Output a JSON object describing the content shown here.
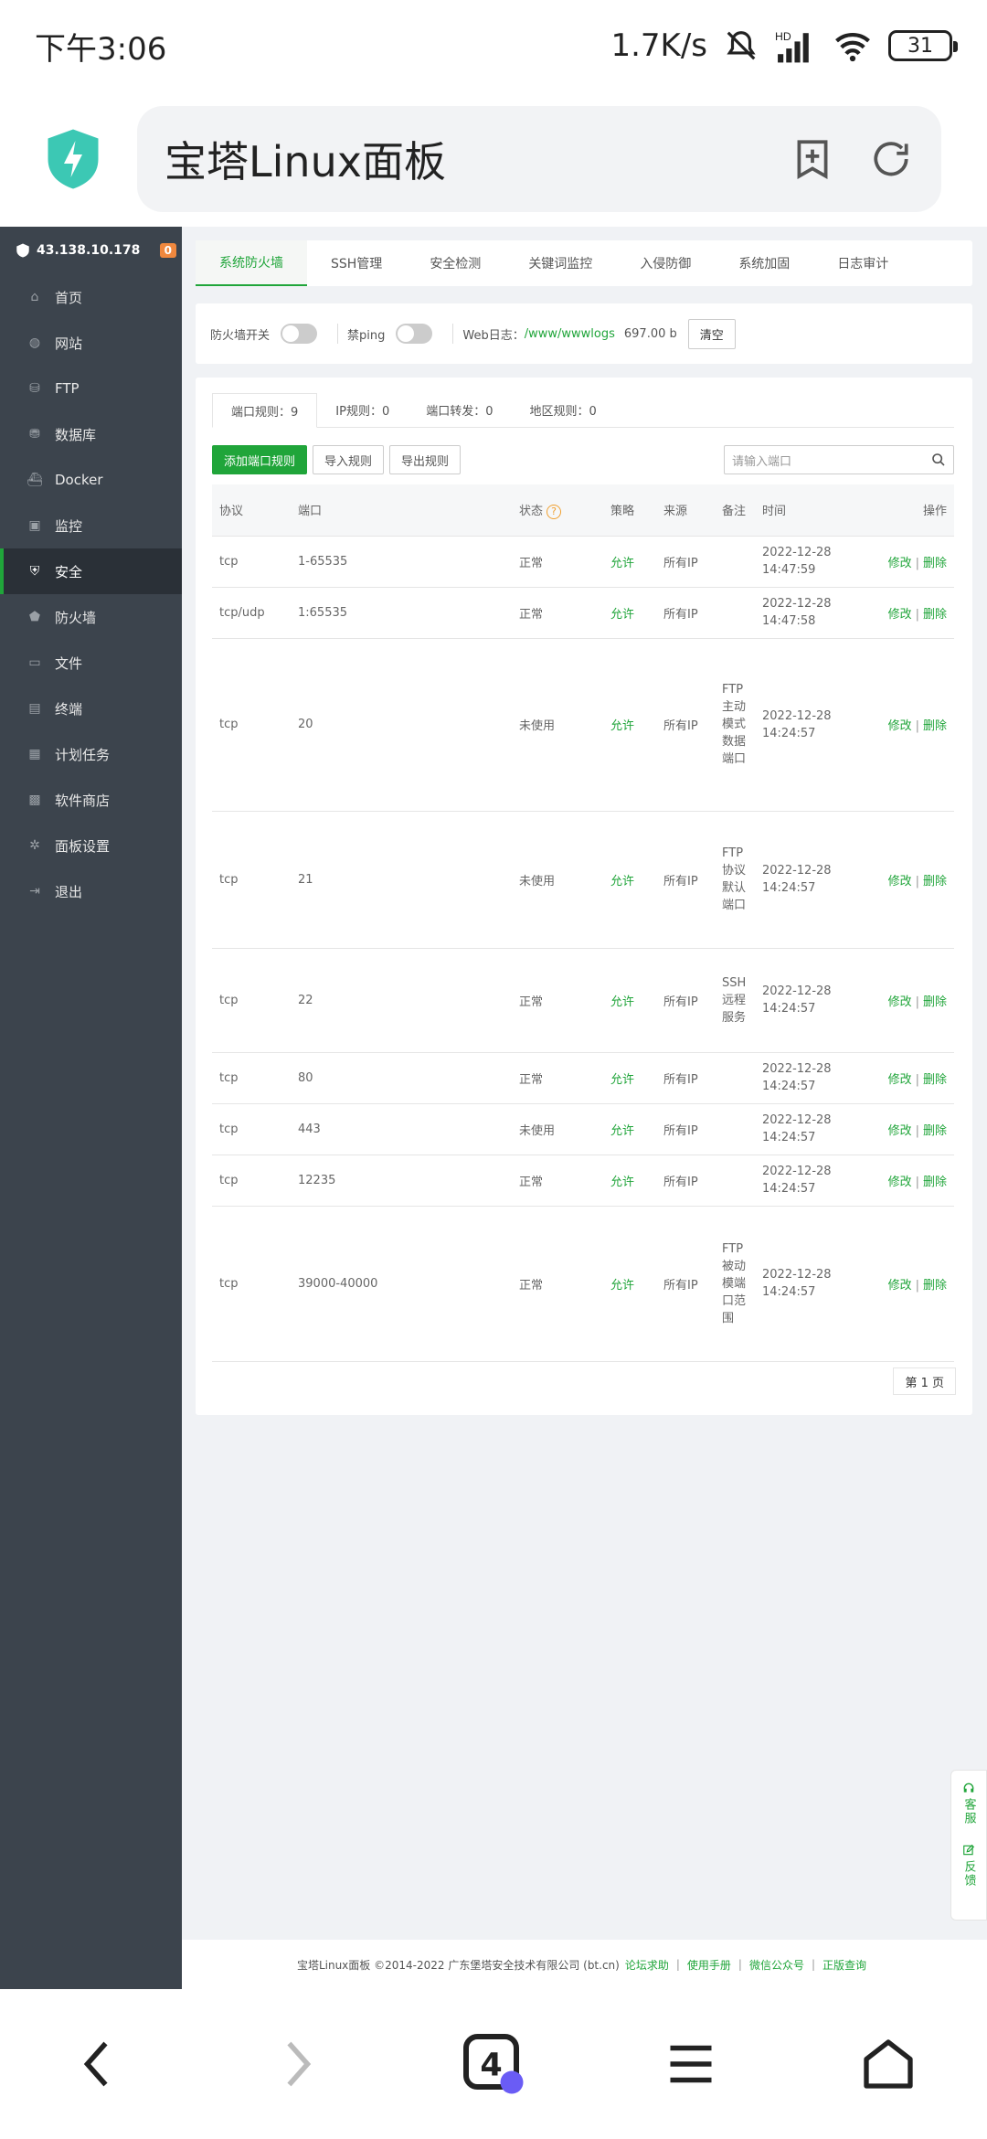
{
  "status_bar": {
    "time": "下午3:06",
    "network_speed": "1.7K/s",
    "battery": "31",
    "signal_label": "HD"
  },
  "browser": {
    "url_title": "宝塔Linux面板",
    "tab_count": "4"
  },
  "sidebar": {
    "ip": "43.138.10.178",
    "badge": "0",
    "items": [
      {
        "label": "首页",
        "icon": "home-icon"
      },
      {
        "label": "网站",
        "icon": "globe-icon"
      },
      {
        "label": "FTP",
        "icon": "ftp-icon"
      },
      {
        "label": "数据库",
        "icon": "database-icon"
      },
      {
        "label": "Docker",
        "icon": "docker-icon"
      },
      {
        "label": "监控",
        "icon": "monitor-icon"
      },
      {
        "label": "安全",
        "icon": "shield-icon"
      },
      {
        "label": "防火墙",
        "icon": "firewall-icon"
      },
      {
        "label": "文件",
        "icon": "folder-icon"
      },
      {
        "label": "终端",
        "icon": "terminal-icon"
      },
      {
        "label": "计划任务",
        "icon": "calendar-icon"
      },
      {
        "label": "软件商店",
        "icon": "apps-icon"
      },
      {
        "label": "面板设置",
        "icon": "gear-icon"
      },
      {
        "label": "退出",
        "icon": "logout-icon"
      }
    ]
  },
  "tabs": [
    "系统防火墙",
    "SSH管理",
    "安全检测",
    "关键词监控",
    "入侵防御",
    "系统加固",
    "日志审计"
  ],
  "controls": {
    "firewall_switch": "防火墙开关",
    "ping_label": "禁ping",
    "weblog_label": "Web日志：",
    "weblog_path": "/www/wwwlogs",
    "weblog_size": "697.00 b",
    "clear_button": "清空"
  },
  "subtabs": [
    "端口规则：9",
    "IP规则：0",
    "端口转发：0",
    "地区规则：0"
  ],
  "actions": {
    "add": "添加端口规则",
    "import": "导入规则",
    "export": "导出规则",
    "search_placeholder": "请输入端口"
  },
  "table": {
    "headers": [
      "协议",
      "端口",
      "状态",
      "策略",
      "来源",
      "备注",
      "时间",
      "操作"
    ],
    "rows": [
      {
        "protocol": "tcp",
        "port": "1-65535",
        "status": "正常",
        "policy": "允许",
        "source": "所有IP",
        "note": "",
        "time": "2022-12-28 14:47:59"
      },
      {
        "protocol": "tcp/udp",
        "port": "1:65535",
        "status": "正常",
        "policy": "允许",
        "source": "所有IP",
        "note": "",
        "time": "2022-12-28 14:47:58"
      },
      {
        "protocol": "tcp",
        "port": "20",
        "status": "未使用",
        "policy": "允许",
        "source": "所有IP",
        "note": "FTP主动模式数据端口",
        "time": "2022-12-28 14:24:57"
      },
      {
        "protocol": "tcp",
        "port": "21",
        "status": "未使用",
        "policy": "允许",
        "source": "所有IP",
        "note": "FTP协议默认端口",
        "time": "2022-12-28 14:24:57"
      },
      {
        "protocol": "tcp",
        "port": "22",
        "status": "正常",
        "policy": "允许",
        "source": "所有IP",
        "note": "SSH远程服务",
        "time": "2022-12-28 14:24:57"
      },
      {
        "protocol": "tcp",
        "port": "80",
        "status": "正常",
        "policy": "允许",
        "source": "所有IP",
        "note": "",
        "time": "2022-12-28 14:24:57"
      },
      {
        "protocol": "tcp",
        "port": "443",
        "status": "未使用",
        "policy": "允许",
        "source": "所有IP",
        "note": "",
        "time": "2022-12-28 14:24:57"
      },
      {
        "protocol": "tcp",
        "port": "12235",
        "status": "正常",
        "policy": "允许",
        "source": "所有IP",
        "note": "",
        "time": "2022-12-28 14:24:57"
      },
      {
        "protocol": "tcp",
        "port": "39000-40000",
        "status": "正常",
        "policy": "允许",
        "source": "所有IP",
        "note": "FTP被动模端口范围",
        "time": "2022-12-28 14:24:57"
      }
    ],
    "op_edit": "修改",
    "op_delete": "删除",
    "op_sep": "|"
  },
  "pager": "第 1 页",
  "footer": {
    "copyright": "宝塔Linux面板 ©2014-2022 广东堡塔安全技术有限公司 (bt.cn)",
    "links": [
      "论坛求助",
      "使用手册",
      "微信公众号",
      "正版查询"
    ],
    "sep": "|"
  },
  "float_side": [
    "客服",
    "反馈"
  ],
  "colors": {
    "accent": "#20a53a",
    "sidebar": "#3c444d",
    "badge": "#f0883e"
  }
}
